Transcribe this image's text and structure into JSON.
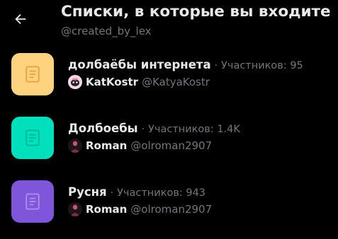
{
  "header": {
    "back_icon": "arrow-left-icon",
    "title": "Списки, в которые вы входите",
    "handle": "@created_by_lex"
  },
  "lists": [
    {
      "name": "долбаёбы интернета",
      "separator": "·",
      "members": "Участников: 95",
      "icon_color": "#ffd27f",
      "icon": "list-document-icon",
      "owner": {
        "name": "KatKostr",
        "handle": "@KatyaKostr",
        "avatar_color": "#f2d7e4"
      }
    },
    {
      "name": "Долбоебы",
      "separator": "·",
      "members": "Участников: 1.4K",
      "icon_color": "#00e0bd",
      "icon": "list-document-icon",
      "owner": {
        "name": "Roman",
        "handle": "@olroman2907",
        "avatar_color": "#2a1a22"
      }
    },
    {
      "name": "Русня",
      "separator": "·",
      "members": "Участников: 943",
      "icon_color": "#7f56d9",
      "icon": "list-document-icon",
      "owner": {
        "name": "Roman",
        "handle": "@olroman2907",
        "avatar_color": "#2a1a22"
      }
    }
  ]
}
